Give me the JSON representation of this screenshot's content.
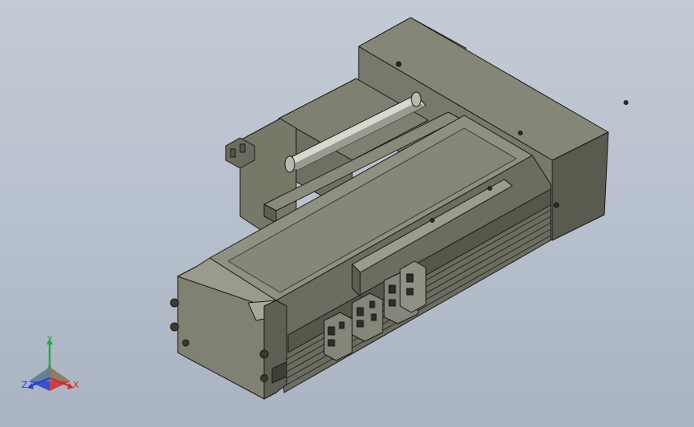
{
  "viewport": {
    "background_top": "#c3cbd6",
    "background_bottom": "#aab3c1"
  },
  "model": {
    "part_color": "#777769",
    "part_color_light": "#8e8e80",
    "part_color_dark": "#4d4d43",
    "edge_color": "#1a1a16",
    "shaft_color": "#d8d8d0"
  },
  "triad": {
    "x_label": "X",
    "y_label": "Y",
    "z_label": "Z",
    "x_color": "#d42a2a",
    "y_color": "#2aa84a",
    "z_color": "#2a3ed4"
  }
}
